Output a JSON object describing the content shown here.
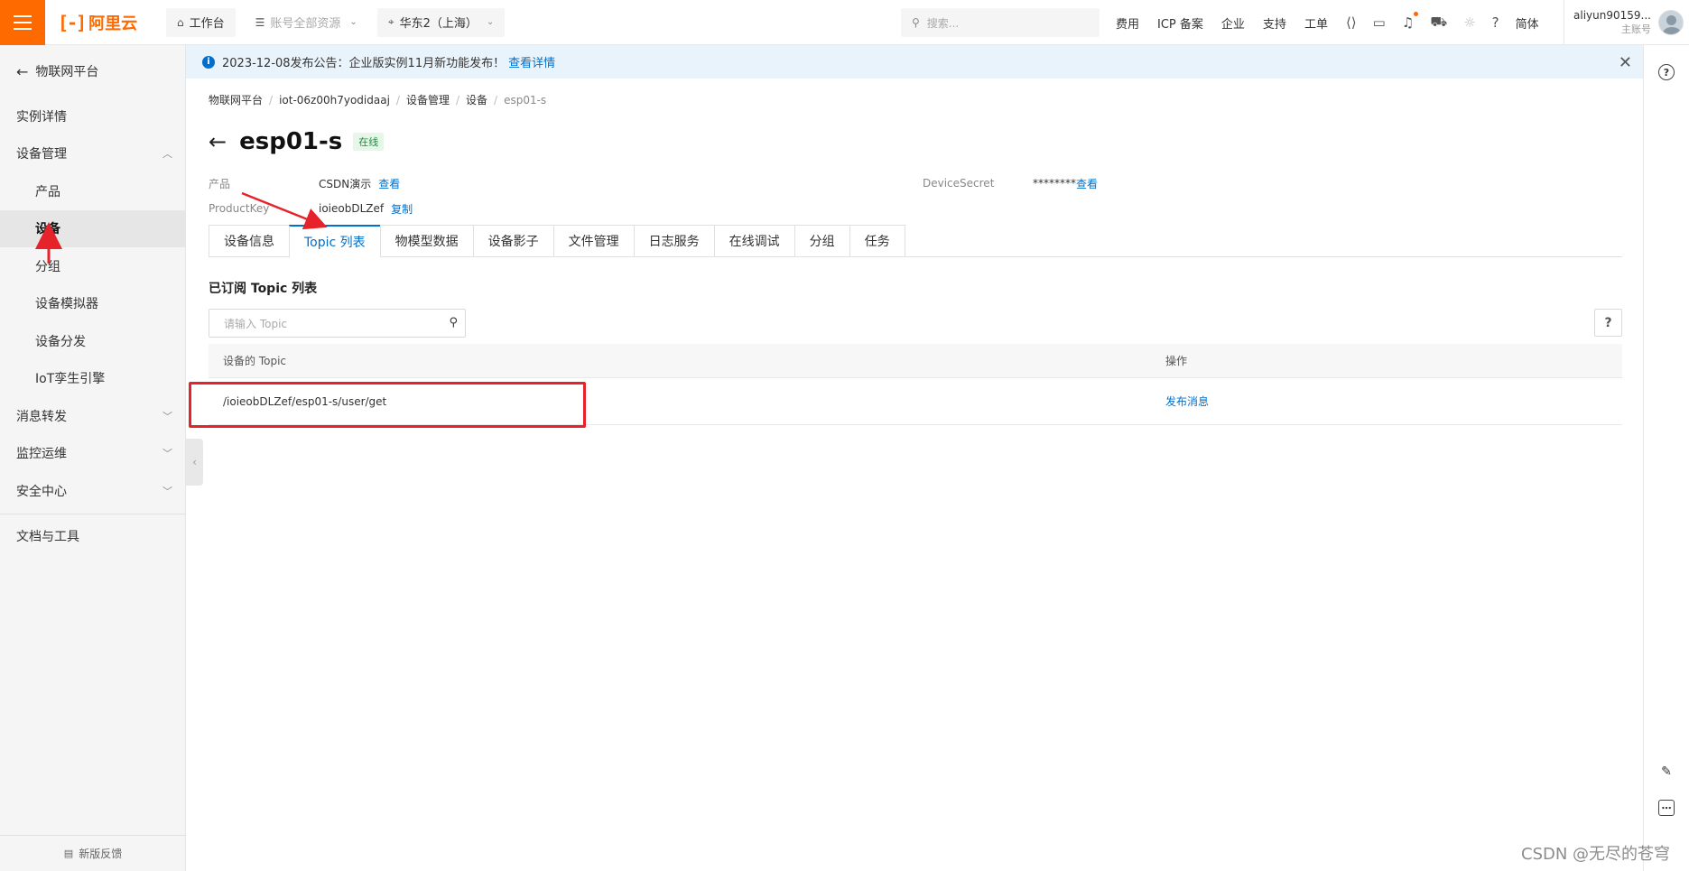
{
  "topbar": {
    "logo_text": "阿里云",
    "workbench": "工作台",
    "resources": "账号全部资源",
    "region": "华东2（上海）",
    "search_placeholder": "搜索...",
    "links": [
      "费用",
      "ICP 备案",
      "企业",
      "支持",
      "工单"
    ],
    "lang": "简体",
    "user_name": "aliyun90159...",
    "user_role": "主账号"
  },
  "sidebar": {
    "back_label": "物联网平台",
    "items": [
      {
        "label": "实例详情"
      },
      {
        "label": "设备管理"
      },
      {
        "label": "产品"
      },
      {
        "label": "设备"
      },
      {
        "label": "分组"
      },
      {
        "label": "设备模拟器"
      },
      {
        "label": "设备分发"
      },
      {
        "label": "IoT孪生引擎"
      },
      {
        "label": "消息转发"
      },
      {
        "label": "监控运维"
      },
      {
        "label": "安全中心"
      },
      {
        "label": "文档与工具"
      }
    ],
    "footer": "新版反馈"
  },
  "notice": {
    "text": "2023-12-08发布公告：企业版实例11月新功能发布！",
    "link": "查看详情"
  },
  "breadcrumb": [
    "物联网平台",
    "iot-06z00h7yodidaaj",
    "设备管理",
    "设备",
    "esp01-s"
  ],
  "device": {
    "name": "esp01-s",
    "status": "在线",
    "product_label": "产品",
    "product_value": "CSDN演示",
    "product_action": "查看",
    "productkey_label": "ProductKey",
    "productkey_value": "ioieobDLZef",
    "productkey_action": "复制",
    "secret_label": "DeviceSecret",
    "secret_value": "********",
    "secret_action": "查看"
  },
  "tabs": [
    "设备信息",
    "Topic 列表",
    "物模型数据",
    "设备影子",
    "文件管理",
    "日志服务",
    "在线调试",
    "分组",
    "任务"
  ],
  "topic_section": {
    "title": "已订阅 Topic 列表",
    "search_placeholder": "请输入 Topic",
    "help": "?",
    "columns": [
      "设备的 Topic",
      "操作"
    ],
    "rows": [
      {
        "topic": "/ioieobDLZef/esp01-s/user/get",
        "action": "发布消息"
      }
    ]
  },
  "watermark": "CSDN @无尽的苍穹",
  "colors": {
    "brand": "#ff6a00",
    "link": "#0070cc",
    "annotation": "#e6232a"
  }
}
